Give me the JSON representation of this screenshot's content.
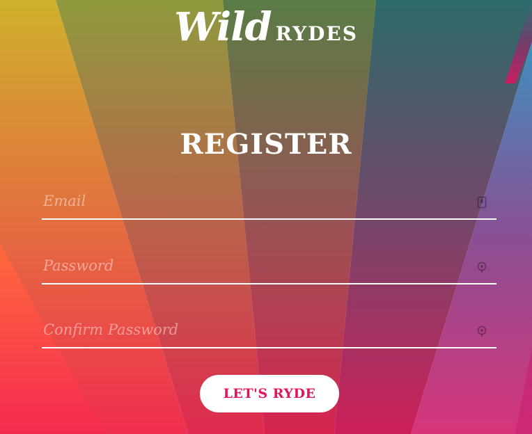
{
  "brand": {
    "wild": "Wild",
    "rydes": "RYDES"
  },
  "form": {
    "title": "REGISTER",
    "email_placeholder": "Email",
    "password_placeholder": "Password",
    "confirm_placeholder": "Confirm Password",
    "submit_label": "LET'S RYDE"
  },
  "icons": {
    "email": "id-card-icon",
    "password": "lock-icon",
    "confirm": "lock-icon"
  },
  "colors": {
    "button_text": "#e4135d",
    "text": "#ffffff"
  }
}
